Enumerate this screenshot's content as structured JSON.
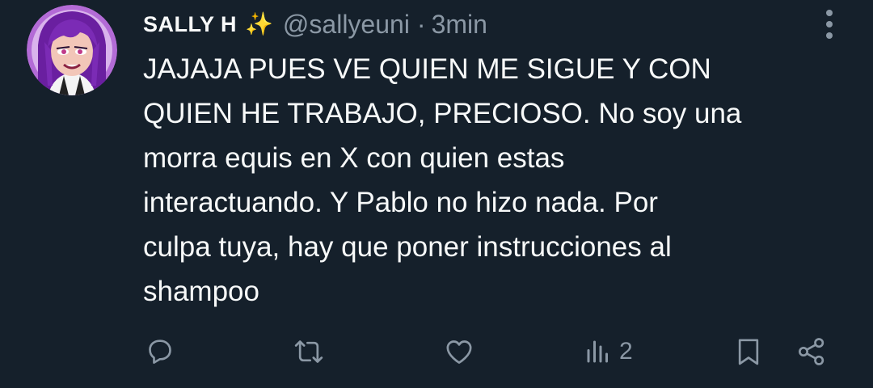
{
  "author": {
    "display_name": "SALLY H",
    "badge_emoji": "✨",
    "handle": "@sallyeuni",
    "separator": "·",
    "timestamp": "3min"
  },
  "tweet": {
    "text": "JAJAJA PUES VE QUIEN ME SIGUE Y CON\nQUIEN HE TRABAJO, PRECIOSO. No soy una\nmorra equis en X con quien estas\ninteractuando. Y Pablo no hizo nada. Por\nculpa tuya, hay que poner instrucciones al\nshampoo"
  },
  "actions": {
    "views_count": "2",
    "icons": [
      "reply-icon",
      "retweet-icon",
      "like-icon",
      "views-icon",
      "bookmark-icon",
      "share-icon"
    ]
  },
  "colors": {
    "background": "#15202b",
    "text_primary": "#f7f9f9",
    "text_secondary": "#8b98a5",
    "avatar_ring": "#b36bd6"
  }
}
